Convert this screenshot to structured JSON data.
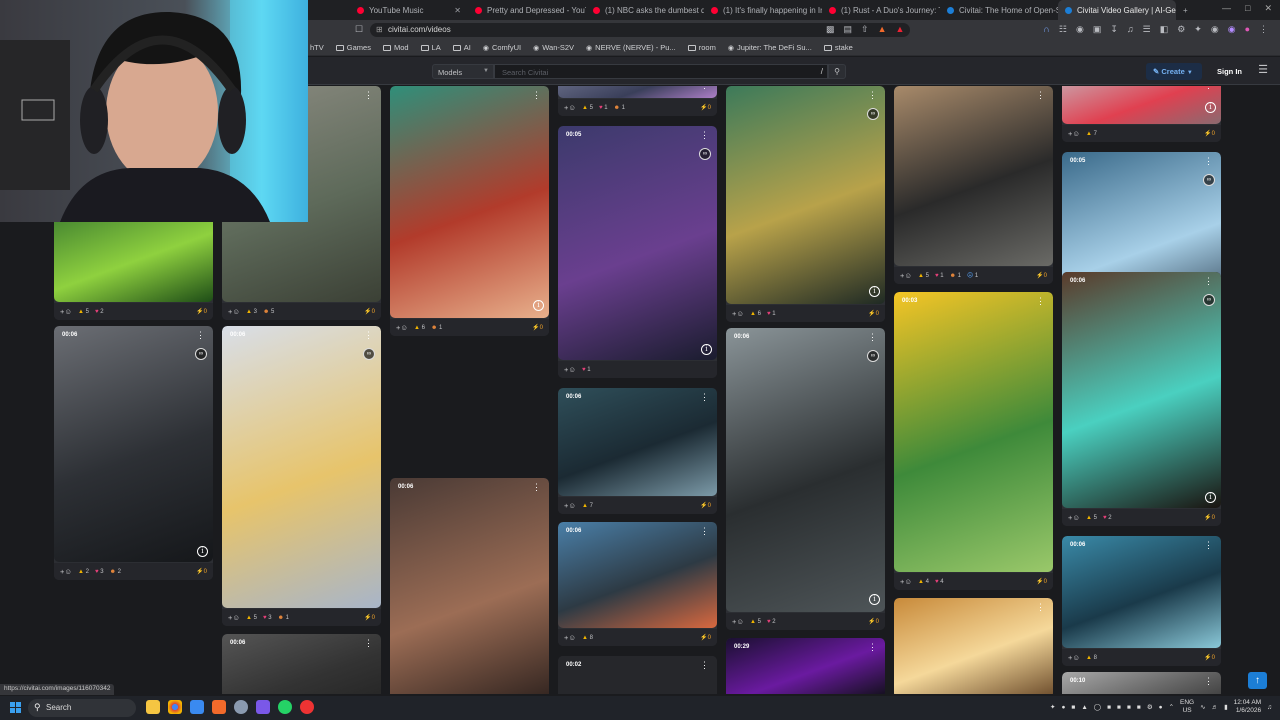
{
  "browser": {
    "tabs": [
      {
        "title": "YouTube Music",
        "color": "#ff0033"
      },
      {
        "title": "Pretty and Depressed - YouTub",
        "color": "#ff0033"
      },
      {
        "title": "(1) NBC asks the dumbest questio",
        "color": "#ff0033"
      },
      {
        "title": "(1) It's finally happening in Iran... -",
        "color": "#ff0033"
      },
      {
        "title": "(1) Rust - A Duo's Journey: The Ri",
        "color": "#ff0033"
      },
      {
        "title": "Civitai: The Home of Open-Source",
        "color": "#1c7ed6"
      },
      {
        "title": "Civitai Video Gallery | AI-Gene",
        "color": "#1c7ed6",
        "active": true
      }
    ],
    "url": "civitai.com/videos",
    "bookmarks": [
      {
        "label": "hTV",
        "icon": "none"
      },
      {
        "label": "Games",
        "icon": "folder"
      },
      {
        "label": "Mod",
        "icon": "folder"
      },
      {
        "label": "LA",
        "icon": "folder"
      },
      {
        "label": "AI",
        "icon": "folder"
      },
      {
        "label": "ComfyUI",
        "icon": "globe"
      },
      {
        "label": "Wan-S2V",
        "icon": "globe"
      },
      {
        "label": "NERVE (NERVE) - Pu...",
        "icon": "globe"
      },
      {
        "label": "room",
        "icon": "folder"
      },
      {
        "label": "Jupiter: The DeFi Su...",
        "icon": "globe"
      },
      {
        "label": "stake",
        "icon": "folder"
      }
    ],
    "status_url": "https://civitai.com/images/116070342"
  },
  "header": {
    "models_label": "Models",
    "search_placeholder": "Search Civitai",
    "search_shortcut": "/",
    "create_label": "Create",
    "signin_label": "Sign In"
  },
  "taskbar": {
    "search_label": "Search",
    "lang_top": "ENG",
    "lang_bottom": "US",
    "time": "12:04 AM",
    "date": "1/6/2026"
  },
  "gallery": {
    "cards": [
      {
        "id": "c1",
        "dur": "",
        "reactions": {
          "like": "5",
          "heart": "2",
          "laugh": "",
          "cry": ""
        },
        "tip": "0",
        "colors": [
          "#3a7a2e",
          "#8fd13f",
          "#1e4d17"
        ]
      },
      {
        "id": "c2",
        "dur": "",
        "reactions": {
          "like": "3",
          "heart": "",
          "laugh": "5",
          "cry": ""
        },
        "tip": "0",
        "colors": [
          "#8a8a80",
          "#5e6a5a",
          "#3b4035"
        ]
      },
      {
        "id": "c3",
        "dur": "00:06",
        "reactions": {
          "like": "2",
          "heart": "3",
          "laugh": "2",
          "cry": ""
        },
        "tip": "0",
        "colors": [
          "#6b6e74",
          "#2d3035",
          "#15171a"
        ]
      },
      {
        "id": "c4",
        "dur": "00:06",
        "reactions": {
          "like": "5",
          "heart": "3",
          "laugh": "1",
          "cry": ""
        },
        "tip": "0",
        "colors": [
          "#d8dee8",
          "#e7c46b",
          "#a8b5c9"
        ]
      },
      {
        "id": "c5",
        "dur": "00:06",
        "reactions": {
          "like": "",
          "heart": "",
          "laugh": "",
          "cry": ""
        },
        "tip": "",
        "colors": [
          "#555",
          "#333",
          "#222"
        ]
      },
      {
        "id": "c6",
        "dur": "",
        "reactions": {
          "like": "6",
          "heart": "",
          "laugh": "1",
          "cry": ""
        },
        "tip": "0",
        "colors": [
          "#2f8f7a",
          "#b23b2b",
          "#e8b08c"
        ]
      },
      {
        "id": "c7",
        "dur": "00:06",
        "reactions": {
          "like": "",
          "heart": "",
          "laugh": "",
          "cry": ""
        },
        "tip": "",
        "colors": [
          "#4a3a35",
          "#9c6d55",
          "#2a1f1c"
        ]
      },
      {
        "id": "c8",
        "dur": "",
        "reactions": {
          "like": "5",
          "heart": "1",
          "laugh": "1",
          "cry": ""
        },
        "tip": "0",
        "colors": [
          "#6a6f8a",
          "#3a3f5a",
          "#ad7fc8"
        ]
      },
      {
        "id": "c9",
        "dur": "00:05",
        "reactions": {
          "like": "",
          "heart": "1",
          "laugh": "",
          "cry": ""
        },
        "tip": "",
        "colors": [
          "#3c3a6c",
          "#6a3f8f",
          "#1a1c2e"
        ]
      },
      {
        "id": "c10",
        "dur": "00:06",
        "reactions": {
          "like": "7",
          "heart": "",
          "laugh": "",
          "cry": ""
        },
        "tip": "0",
        "colors": [
          "#2f4f5a",
          "#1b2a33",
          "#7c9aa8"
        ]
      },
      {
        "id": "c11",
        "dur": "00:06",
        "reactions": {
          "like": "8",
          "heart": "",
          "laugh": "",
          "cry": ""
        },
        "tip": "0",
        "colors": [
          "#4a7fa8",
          "#2d3a44",
          "#d8683f"
        ]
      },
      {
        "id": "c12",
        "dur": "00:02",
        "reactions": {
          "like": "",
          "heart": "",
          "laugh": "",
          "cry": ""
        },
        "tip": "",
        "colors": [
          "#26272b",
          "#26272b",
          "#26272b"
        ]
      },
      {
        "id": "c13",
        "dur": "",
        "reactions": {
          "like": "6",
          "heart": "1",
          "laugh": "",
          "cry": ""
        },
        "tip": "0",
        "colors": [
          "#3c7a5a",
          "#b8a24a",
          "#1f2a24"
        ]
      },
      {
        "id": "c14",
        "dur": "00:06",
        "reactions": {
          "like": "5",
          "heart": "2",
          "laugh": "",
          "cry": ""
        },
        "tip": "0",
        "colors": [
          "#8a9498",
          "#2a2e30",
          "#4e5558"
        ]
      },
      {
        "id": "c15",
        "dur": "00:29",
        "reactions": {
          "like": "",
          "heart": "",
          "laugh": "",
          "cry": ""
        },
        "tip": "",
        "colors": [
          "#1a1030",
          "#6a1aa0",
          "#101018"
        ]
      },
      {
        "id": "c16",
        "dur": "",
        "reactions": {
          "like": "5",
          "heart": "1",
          "laugh": "1",
          "cry": "1"
        },
        "tip": "0",
        "colors": [
          "#a88a6a",
          "#2a2a2a",
          "#6a6a66"
        ]
      },
      {
        "id": "c17",
        "dur": "00:03",
        "reactions": {
          "like": "4",
          "heart": "4",
          "laugh": "",
          "cry": ""
        },
        "tip": "0",
        "colors": [
          "#f5c525",
          "#3e8a3a",
          "#9ac86a"
        ]
      },
      {
        "id": "c18",
        "dur": "",
        "reactions": {
          "like": "",
          "heart": "",
          "laugh": "",
          "cry": ""
        },
        "tip": "",
        "colors": [
          "#c88a3a",
          "#f5d89a",
          "#6a4a2a"
        ]
      },
      {
        "id": "c19",
        "dur": "",
        "reactions": {
          "like": "7",
          "heart": "",
          "laugh": "",
          "cry": ""
        },
        "tip": "0",
        "colors": [
          "#c8a8b0",
          "#e04050",
          "#8a6a70"
        ]
      },
      {
        "id": "c20",
        "dur": "00:05",
        "reactions": {
          "like": "5",
          "heart": "2",
          "laugh": "",
          "cry": ""
        },
        "tip": "0",
        "colors": [
          "#3a6a8a",
          "#a8d0e8",
          "#1a2a3a"
        ]
      },
      {
        "id": "c21",
        "dur": "00:06",
        "reactions": {
          "like": "5",
          "heart": "2",
          "laugh": "",
          "cry": ""
        },
        "tip": "0",
        "colors": [
          "#5a3a2a",
          "#4ad0c0",
          "#1a1410"
        ]
      },
      {
        "id": "c22",
        "dur": "00:06",
        "reactions": {
          "like": "8",
          "heart": "",
          "laugh": "",
          "cry": ""
        },
        "tip": "0",
        "colors": [
          "#3a8aa8",
          "#1a3a4a",
          "#8ac8d8"
        ]
      },
      {
        "id": "c23",
        "dur": "00:10",
        "reactions": {
          "like": "",
          "heart": "",
          "laugh": "",
          "cry": ""
        },
        "tip": "",
        "colors": [
          "#a8a8a8",
          "#6a6a6a",
          "#3a3a3a"
        ]
      },
      {
        "id": "c24",
        "dur": "",
        "reactions": {
          "like": "",
          "heart": "",
          "laugh": "",
          "cry": ""
        },
        "tip": "",
        "colors": [
          "#2a2a2a",
          "#444",
          "#1a1a1a"
        ]
      }
    ]
  }
}
